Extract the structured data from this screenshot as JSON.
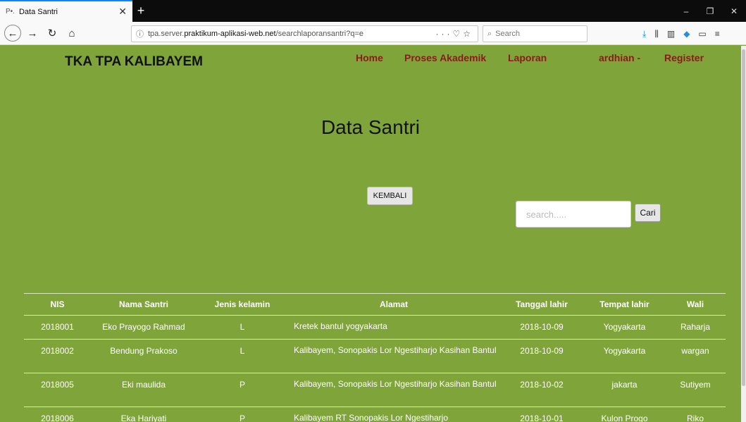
{
  "browser": {
    "tab_title": "Data Santri",
    "url_prefix": "tpa.server.",
    "url_domain": "praktikum-aplikasi-web.net",
    "url_path": "/searchlaporansantri?q=e",
    "search_placeholder": "Search"
  },
  "site": {
    "brand": "TKA TPA KALIBAYEM",
    "menu": [
      {
        "label": "Home"
      },
      {
        "label": "Proses Akademik"
      },
      {
        "label": "Laporan"
      },
      {
        "label": "ardhian -"
      },
      {
        "label": "Register"
      }
    ]
  },
  "main": {
    "heading": "Data Santri",
    "back_label": "KEMBALI",
    "search_placeholder": "search.....",
    "search_button": "Cari"
  },
  "table": {
    "columns": [
      "NIS",
      "Nama Santri",
      "Jenis kelamin",
      "Alamat",
      "Tanggal lahir",
      "Tempat lahir",
      "Wali"
    ],
    "rows": [
      [
        "2018001",
        "Eko Prayogo Rahmad",
        "L",
        "Kretek bantul yogyakarta",
        "2018-10-09",
        "Yogyakarta",
        "Raharja"
      ],
      [
        "2018002",
        "Bendung Prakoso",
        "L",
        "Kalibayem, Sonopakis Lor Ngestiharjo Kasihan Bantul",
        "2018-10-09",
        "Yogyakarta",
        "wargan"
      ],
      [
        "2018005",
        "Eki maulida",
        "P",
        "Kalibayem, Sonopakis Lor Ngestiharjo Kasihan Bantul",
        "2018-10-02",
        "jakarta",
        "Sutiyem"
      ],
      [
        "2018006",
        "Eka Hariyati",
        "P",
        "Kalibayem RT Sonopakis Lor Ngestiharjo",
        "2018-10-01",
        "Kulon Progo",
        "Riko"
      ]
    ]
  },
  "colors": {
    "page_bg": "#7fa53a",
    "menu_link": "#8b1a1a"
  }
}
